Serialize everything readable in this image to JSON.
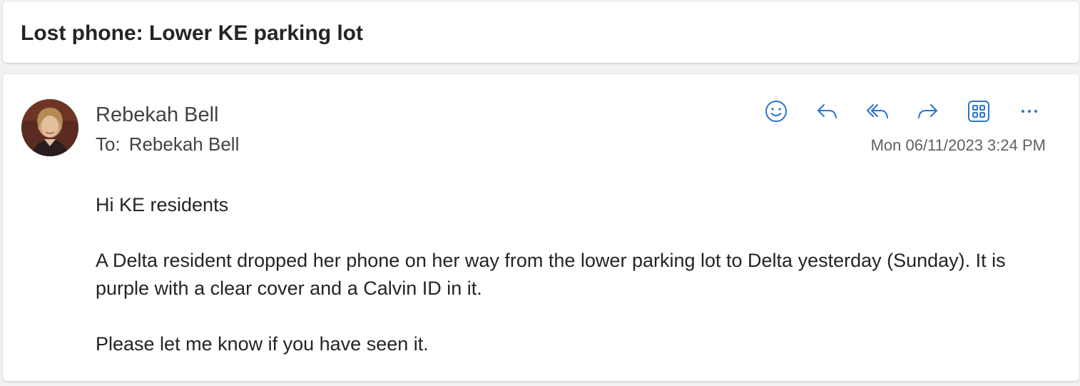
{
  "subject": "Lost phone: Lower KE parking lot",
  "sender": {
    "name": "Rebekah Bell",
    "avatar_alt": "Rebekah Bell"
  },
  "recipients": {
    "label": "To:",
    "names": "Rebekah Bell"
  },
  "timestamp": "Mon 06/11/2023 3:24 PM",
  "actions": [
    {
      "name": "react",
      "icon": "smiley-icon"
    },
    {
      "name": "reply",
      "icon": "reply-icon"
    },
    {
      "name": "reply-all",
      "icon": "reply-all-icon"
    },
    {
      "name": "forward",
      "icon": "forward-icon"
    },
    {
      "name": "apps",
      "icon": "apps-grid-icon"
    },
    {
      "name": "more-actions",
      "icon": "ellipsis-icon"
    }
  ],
  "body": {
    "greeting": "Hi KE residents",
    "paragraph_1": "A Delta resident dropped her phone on her way from the lower parking lot to Delta yesterday (Sunday). It is purple with a clear cover and a Calvin ID in it.",
    "paragraph_2": "Please let me know if you have seen it."
  },
  "colors": {
    "accent": "#2b74c8",
    "text": "#242424",
    "muted": "#616161"
  }
}
